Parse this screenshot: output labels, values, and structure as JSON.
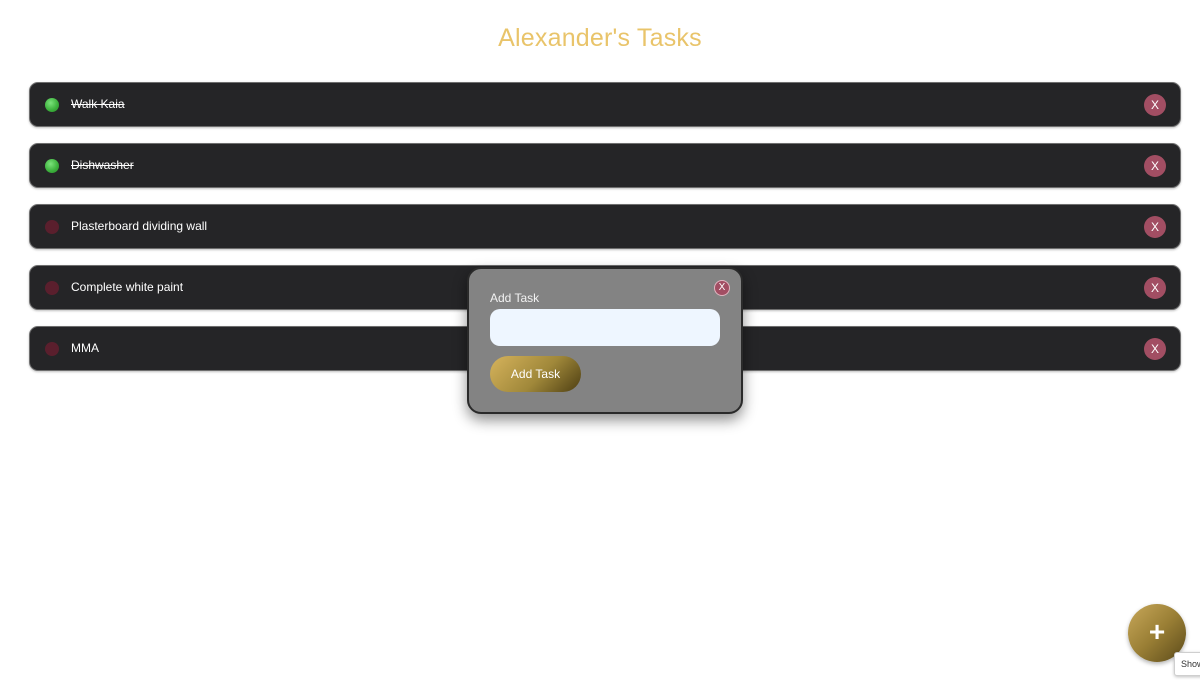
{
  "header": {
    "title": "Alexander's Tasks"
  },
  "tasks": [
    {
      "label": "Walk Kaia",
      "completed": true,
      "delete_label": "X"
    },
    {
      "label": "Dishwasher",
      "completed": true,
      "delete_label": "X"
    },
    {
      "label": "Plasterboard dividing wall",
      "completed": false,
      "delete_label": "X"
    },
    {
      "label": "Complete white paint",
      "completed": false,
      "delete_label": "X"
    },
    {
      "label": "MMA",
      "completed": false,
      "delete_label": "X"
    }
  ],
  "modal": {
    "close_label": "X",
    "field_label": "Add Task",
    "input_value": "",
    "submit_label": "Add Task"
  },
  "fab": {
    "icon": "plus-icon",
    "glyph": "+"
  },
  "tooltip": {
    "text": "Show"
  },
  "colors": {
    "title": "#e9c46a",
    "task_background": "#252527",
    "delete_button": "#a24e63",
    "done_dot": "#3fb33f",
    "todo_dot": "#5a1f2d",
    "modal_background": "#838383",
    "input_background": "#eef6ff",
    "gold_button": "#a0883a"
  }
}
